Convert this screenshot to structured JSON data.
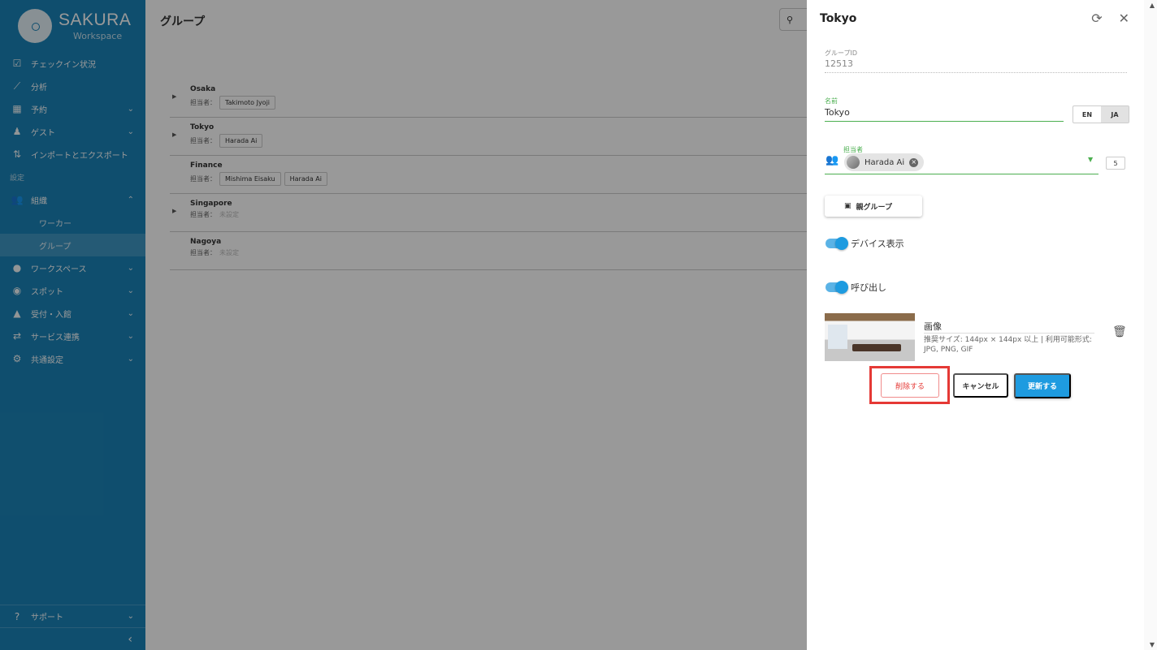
{
  "app": {
    "brand": "SAKURA",
    "brand_sub": "Workspace"
  },
  "sidebar": {
    "items": [
      {
        "label": "チェックイン状況",
        "icon": "checkbox-icon"
      },
      {
        "label": "分析",
        "icon": "chart-icon"
      },
      {
        "label": "予約",
        "icon": "calendar-icon"
      },
      {
        "label": "ゲスト",
        "icon": "guest-icon"
      },
      {
        "label": "インポートとエクスポート",
        "icon": "import-export-icon"
      }
    ],
    "section_label": "設定",
    "org_label": "組織",
    "org_sub": [
      "ワーカー",
      "グループ"
    ],
    "lower_items": [
      {
        "label": "ワークスペース",
        "icon": "pin-icon"
      },
      {
        "label": "スポット",
        "icon": "spot-icon"
      },
      {
        "label": "受付・入館",
        "icon": "reception-icon"
      },
      {
        "label": "サービス連携",
        "icon": "integration-icon"
      },
      {
        "label": "共通設定",
        "icon": "settings-icon"
      }
    ],
    "support_label": "サポート"
  },
  "main": {
    "title": "グループ",
    "manager_prefix": "担当者：",
    "unset_label": "未設定",
    "groups": [
      {
        "name": "Osaka",
        "managers": [
          "Takimoto Jyoji"
        ],
        "expandable": true
      },
      {
        "name": "Tokyo",
        "managers": [
          "Harada Ai"
        ],
        "expandable": true
      },
      {
        "name": "Finance",
        "managers": [
          "Mishima Eisaku",
          "Harada Ai"
        ],
        "expandable": false
      },
      {
        "name": "Singapore",
        "managers": [],
        "expandable": true
      },
      {
        "name": "Nagoya",
        "managers": [],
        "expandable": false
      }
    ]
  },
  "drawer": {
    "title": "Tokyo",
    "group_id_label": "グループID",
    "group_id_value": "12513",
    "name_label": "名前",
    "name_value": "Tokyo",
    "lang_en": "EN",
    "lang_ja": "JA",
    "manager_label": "担当者",
    "manager_chip": "Harada Ai",
    "manager_count": "5",
    "parent_group_label": "親グループ",
    "device_display_label": "デバイス表示",
    "call_label": "呼び出し",
    "image_label": "画像",
    "image_desc": "推奨サイズ: 144px × 144px 以上 | 利用可能形式: JPG, PNG, GIF",
    "delete_label": "削除する",
    "cancel_label": "キャンセル",
    "update_label": "更新する"
  },
  "colors": {
    "sidebar": "#1a83b8",
    "accent": "#1e9be0",
    "green": "#4caf50",
    "danger": "#e53935"
  }
}
